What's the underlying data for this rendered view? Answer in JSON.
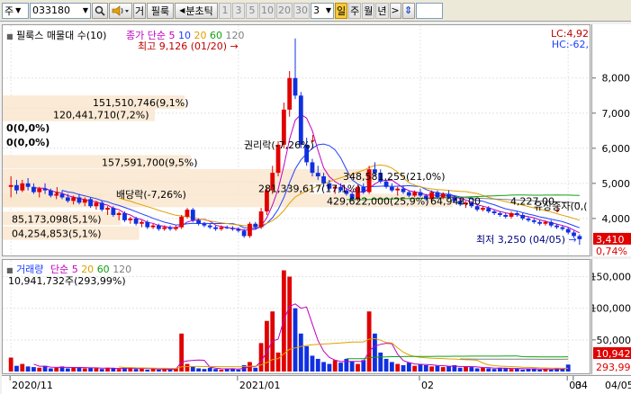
{
  "toolbar": {
    "market": "주",
    "code": "033180",
    "cursor_btn": "거",
    "filter_btn": "필룩",
    "period_label": "분초틱",
    "periods": [
      "1",
      "3",
      "5",
      "10",
      "20",
      "30"
    ],
    "count_value": "3",
    "day": "일",
    "week": "주",
    "month": "월",
    "year": "년",
    "next": ">",
    "updown": "⇕"
  },
  "price_legend": {
    "title": "필룩스 매물대 수(10)",
    "ma_label": "종가 단순",
    "ma_periods": [
      "5",
      "10",
      "20",
      "60",
      "120"
    ],
    "ma_colors": [
      "#c000c0",
      "#2040ff",
      "#e0a000",
      "#10a010",
      "#808080"
    ]
  },
  "price_right": {
    "lc": "LC:4,92",
    "hc": "HC:-62,"
  },
  "annotations": {
    "high": "최고 9,126 (01/20)",
    "low": "최저 3,250 (04/05)",
    "rights": "권리락(-7,26%)",
    "dividend": "배당락(-7,26%)",
    "capital": "유상증자(0,(",
    "zero1": "0(0,0%)",
    "zero2": "0(0,0%)"
  },
  "volume_profile": [
    {
      "label": "151,510,746(9,1%)",
      "price": 7300,
      "value": 151510746
    },
    {
      "label": "120,441,710(7,2%)",
      "price": 6950,
      "value": 120441710
    },
    {
      "label": "157,591,700(9,5%)",
      "price": 5600,
      "value": 157591700
    },
    {
      "label": "348,581,255(21,0%)",
      "price": 5200,
      "value": 348581255
    },
    {
      "label": "281,339,617(17,1%)",
      "price": 4850,
      "value": 281339617
    },
    {
      "label": "429,622,000(25,9%)",
      "price": 4500,
      "value": 429622000
    },
    {
      "label": "64,948,00",
      "price": 4500,
      "value": 64948000
    },
    {
      "label": "4,227,00",
      "price": 4500,
      "value": 4227000
    },
    {
      "label": "85,173,098(5,1%)",
      "price": 3990,
      "value": 85173098
    },
    {
      "label": "04,254,853(5,1%)",
      "price": 3570,
      "value": 104254853
    }
  ],
  "price_axis": {
    "ticks": [
      "8,000",
      "7,000",
      "6,000",
      "5,000",
      "4,000"
    ],
    "current": "3,410",
    "change": "0,74%"
  },
  "volume_legend": {
    "title": "거래량",
    "ma_label": "단순",
    "ma_periods": [
      "5",
      "20",
      "60",
      "120"
    ],
    "ma_colors": [
      "#c000c0",
      "#e0a000",
      "#10a010",
      "#808080"
    ],
    "info": "10,941,732주(293,99%)"
  },
  "volume_axis": {
    "ticks": [
      "150,000",
      "100,000",
      "50,000"
    ],
    "current": "10,942",
    "pct": "293,99"
  },
  "date_axis": [
    "2020/11",
    "2021/01",
    "02",
    "03",
    "04",
    "04/05"
  ],
  "chart_data": [
    {
      "type": "candlestick",
      "title": "필룩스 매물대 수(10)",
      "unit": "KRW",
      "ylim": [
        3100,
        9300
      ],
      "candles": [
        [
          4900,
          5200,
          4600,
          4950
        ],
        [
          4950,
          5100,
          4700,
          4800
        ],
        [
          4800,
          5100,
          4750,
          5000
        ],
        [
          5000,
          5150,
          4800,
          4900
        ],
        [
          4900,
          5000,
          4700,
          4750
        ],
        [
          4750,
          4900,
          4600,
          4850
        ],
        [
          4850,
          5000,
          4700,
          4800
        ],
        [
          4800,
          4850,
          4600,
          4650
        ],
        [
          4650,
          4750,
          4550,
          4700
        ],
        [
          4700,
          4800,
          4550,
          4600
        ],
        [
          4600,
          4700,
          4450,
          4500
        ],
        [
          4500,
          4650,
          4400,
          4600
        ],
        [
          4600,
          4700,
          4400,
          4450
        ],
        [
          4450,
          4600,
          4350,
          4550
        ],
        [
          4550,
          4600,
          4300,
          4350
        ],
        [
          4350,
          4500,
          4250,
          4450
        ],
        [
          4450,
          4500,
          4200,
          4250
        ],
        [
          4250,
          4350,
          4100,
          4300
        ],
        [
          4300,
          4350,
          4050,
          4100
        ],
        [
          4100,
          4200,
          3950,
          4150
        ],
        [
          4150,
          4200,
          3900,
          3950
        ],
        [
          3950,
          4050,
          3850,
          4000
        ],
        [
          4000,
          4050,
          3800,
          3850
        ],
        [
          3850,
          3950,
          3750,
          3900
        ],
        [
          3900,
          3950,
          3700,
          3750
        ],
        [
          3750,
          3850,
          3700,
          3800
        ],
        [
          3800,
          3850,
          3650,
          3700
        ],
        [
          3700,
          3800,
          3650,
          3750
        ],
        [
          3750,
          3800,
          3650,
          3700
        ],
        [
          3700,
          3800,
          3650,
          3750
        ],
        [
          3750,
          4100,
          3700,
          4050
        ],
        [
          4050,
          4300,
          4000,
          4250
        ],
        [
          4250,
          4300,
          3900,
          3950
        ],
        [
          3950,
          4000,
          3800,
          3850
        ],
        [
          3850,
          3900,
          3750,
          3800
        ],
        [
          3800,
          3850,
          3700,
          3750
        ],
        [
          3750,
          3800,
          3650,
          3700
        ],
        [
          3700,
          3800,
          3650,
          3750
        ],
        [
          3750,
          3800,
          3700,
          3720
        ],
        [
          3720,
          3780,
          3650,
          3700
        ],
        [
          3700,
          3750,
          3600,
          3650
        ],
        [
          3650,
          3700,
          3450,
          3500
        ],
        [
          3500,
          3900,
          3450,
          3850
        ],
        [
          3850,
          3900,
          3700,
          3750
        ],
        [
          3750,
          4300,
          3700,
          4200
        ],
        [
          4200,
          4900,
          4100,
          4800
        ],
        [
          4800,
          5500,
          4700,
          5300
        ],
        [
          5300,
          6200,
          5200,
          6100
        ],
        [
          6100,
          7300,
          6000,
          7100
        ],
        [
          7100,
          8200,
          6900,
          8000
        ],
        [
          8000,
          9126,
          7400,
          7500
        ],
        [
          7500,
          7600,
          6000,
          6100
        ],
        [
          6100,
          6300,
          5500,
          5600
        ],
        [
          5600,
          5700,
          5200,
          5300
        ],
        [
          5300,
          5500,
          5100,
          5200
        ],
        [
          5200,
          5300,
          4900,
          5000
        ],
        [
          5000,
          5100,
          4800,
          4850
        ],
        [
          4850,
          4950,
          4700,
          4900
        ],
        [
          4900,
          5000,
          4750,
          4800
        ],
        [
          4800,
          4850,
          4650,
          4700
        ],
        [
          4700,
          4750,
          4500,
          4550
        ],
        [
          4550,
          4950,
          4500,
          4900
        ],
        [
          4900,
          5000,
          4700,
          4750
        ],
        [
          4750,
          5500,
          4700,
          5400
        ],
        [
          5400,
          5600,
          5200,
          5300
        ],
        [
          5300,
          5400,
          5000,
          5050
        ],
        [
          5050,
          5100,
          4850,
          4900
        ],
        [
          4900,
          5000,
          4750,
          4800
        ],
        [
          4800,
          4900,
          4650,
          4850
        ],
        [
          4850,
          4950,
          4700,
          4750
        ],
        [
          4750,
          4800,
          4600,
          4650
        ],
        [
          4650,
          4800,
          4600,
          4750
        ],
        [
          4750,
          4850,
          4600,
          4650
        ],
        [
          4650,
          4700,
          4500,
          4550
        ],
        [
          4550,
          4800,
          4500,
          4750
        ],
        [
          4750,
          4800,
          4550,
          4600
        ],
        [
          4600,
          4750,
          4550,
          4700
        ],
        [
          4700,
          4800,
          4550,
          4600
        ],
        [
          4600,
          4650,
          4450,
          4500
        ],
        [
          4500,
          4550,
          4350,
          4400
        ],
        [
          4400,
          4500,
          4300,
          4450
        ],
        [
          4450,
          4500,
          4300,
          4350
        ],
        [
          4350,
          4400,
          4200,
          4250
        ],
        [
          4250,
          4350,
          4200,
          4300
        ],
        [
          4300,
          4350,
          4150,
          4200
        ],
        [
          4200,
          4250,
          4100,
          4150
        ],
        [
          4150,
          4200,
          4050,
          4100
        ],
        [
          4100,
          4150,
          4000,
          4050
        ],
        [
          4050,
          4200,
          4000,
          4150
        ],
        [
          4150,
          4200,
          4050,
          4100
        ],
        [
          4100,
          4150,
          3950,
          4000
        ],
        [
          4000,
          4050,
          3900,
          3950
        ],
        [
          3950,
          4000,
          3850,
          3900
        ],
        [
          3900,
          3950,
          3800,
          3850
        ],
        [
          3850,
          3950,
          3800,
          3900
        ],
        [
          3900,
          3950,
          3750,
          3800
        ],
        [
          3800,
          3850,
          3700,
          3750
        ],
        [
          3750,
          3800,
          3650,
          3700
        ],
        [
          3700,
          3750,
          3550,
          3600
        ],
        [
          3600,
          3650,
          3450,
          3500
        ],
        [
          3500,
          3550,
          3250,
          3410
        ]
      ]
    },
    {
      "type": "bar",
      "title": "거래량",
      "unit": "1,000주",
      "ylim": [
        0,
        165000
      ],
      "values": [
        22000,
        9000,
        12000,
        8000,
        7000,
        6000,
        9000,
        5000,
        6000,
        8000,
        5000,
        7000,
        6000,
        5000,
        6000,
        5000,
        4000,
        6000,
        5000,
        4000,
        6000,
        5000,
        4000,
        6000,
        3000,
        4000,
        3000,
        4000,
        3000,
        5000,
        60000,
        12000,
        8000,
        5000,
        4000,
        6000,
        4000,
        3000,
        4000,
        5000,
        3000,
        10000,
        15000,
        6000,
        45000,
        80000,
        95000,
        30000,
        160000,
        150000,
        100000,
        60000,
        40000,
        25000,
        20000,
        15000,
        12000,
        18000,
        14000,
        20000,
        16000,
        12000,
        18000,
        95000,
        60000,
        30000,
        20000,
        15000,
        12000,
        10000,
        14000,
        9000,
        12000,
        10000,
        8000,
        9000,
        7000,
        8000,
        10000,
        6000,
        8000,
        7000,
        5000,
        6000,
        5000,
        4000,
        6000,
        5000,
        4000,
        5000,
        3000,
        4000,
        5000,
        3000,
        4000,
        3000,
        5000,
        4000,
        10942
      ]
    }
  ]
}
